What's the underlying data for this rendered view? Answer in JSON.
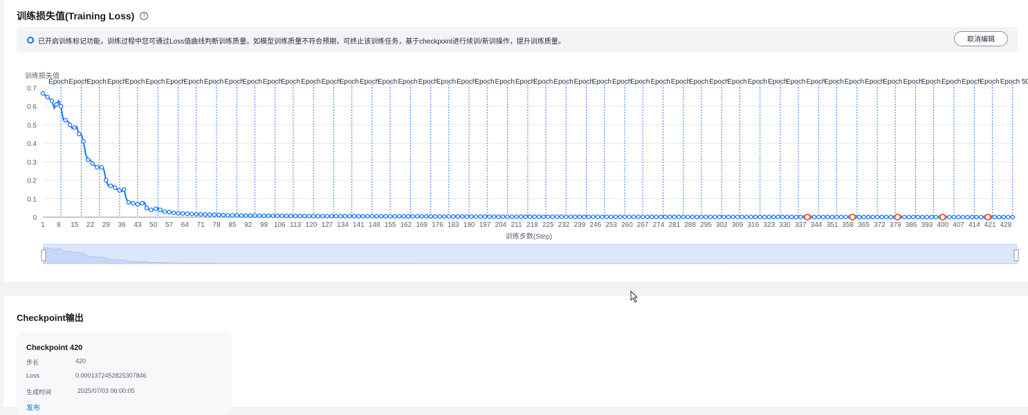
{
  "loss_section": {
    "title": "训练损失值(Training Loss)",
    "help_icon": "question-circle-icon",
    "notice": {
      "icon": "radio-info-icon",
      "text": "已开启训练标记功能，训练过程中您可通过Loss值曲线判断训练质量。如模型训练质量不符合预期，可终止该训练任务，基于checkpoint进行续训/新训操作，提升训练质量。",
      "button_label": "取消编辑"
    }
  },
  "colors": {
    "line": "#1476ff",
    "marker": "#ff5b2a",
    "grid": "#e6e8ec",
    "epoch_line": "#2e7cf6",
    "zoom_fill": "#dce7fb"
  },
  "chart_data": {
    "type": "line",
    "ylabel": "训练损失值",
    "xlabel": "训练步数(Step)",
    "ylim": [
      0,
      0.7
    ],
    "yticks": [
      0,
      0.1,
      0.2,
      0.3,
      0.4,
      0.5,
      0.6,
      0.7
    ],
    "xlim": [
      1,
      432
    ],
    "xticks": [
      1,
      8,
      15,
      22,
      29,
      36,
      43,
      50,
      57,
      64,
      71,
      78,
      85,
      92,
      99,
      106,
      113,
      120,
      127,
      134,
      141,
      148,
      155,
      162,
      169,
      176,
      183,
      190,
      197,
      204,
      211,
      218,
      225,
      232,
      239,
      246,
      253,
      260,
      267,
      274,
      281,
      288,
      295,
      302,
      309,
      316,
      323,
      330,
      337,
      344,
      351,
      358,
      365,
      372,
      379,
      386,
      393,
      400,
      407,
      414,
      421,
      428
    ],
    "epoch_label": "Epoch",
    "epoch_last_number": "50",
    "epoch_steps": [
      9,
      18,
      26,
      35,
      43,
      52,
      61,
      69,
      78,
      87,
      95,
      104,
      112,
      121,
      130,
      138,
      147,
      155,
      164,
      173,
      181,
      190,
      198,
      207,
      216,
      224,
      233,
      242,
      250,
      259,
      267,
      276,
      285,
      293,
      302,
      310,
      319,
      328,
      336,
      345,
      353,
      362,
      371,
      379,
      388,
      396,
      405,
      414,
      422,
      431
    ],
    "loss_curve": [
      [
        1,
        0.67
      ],
      [
        3,
        0.65
      ],
      [
        5,
        0.63
      ],
      [
        6,
        0.59
      ],
      [
        7,
        0.61
      ],
      [
        8,
        0.63
      ],
      [
        9,
        0.6
      ],
      [
        10,
        0.53
      ],
      [
        12,
        0.52
      ],
      [
        14,
        0.48
      ],
      [
        16,
        0.49
      ],
      [
        17,
        0.45
      ],
      [
        18,
        0.45
      ],
      [
        19,
        0.41
      ],
      [
        20,
        0.34
      ],
      [
        21,
        0.31
      ],
      [
        22,
        0.31
      ],
      [
        23,
        0.29
      ],
      [
        25,
        0.27
      ],
      [
        27,
        0.27
      ],
      [
        28,
        0.26
      ],
      [
        29,
        0.2
      ],
      [
        30,
        0.17
      ],
      [
        32,
        0.17
      ],
      [
        34,
        0.15
      ],
      [
        36,
        0.14
      ],
      [
        37,
        0.15
      ],
      [
        38,
        0.1
      ],
      [
        39,
        0.08
      ],
      [
        40,
        0.08
      ],
      [
        42,
        0.07
      ],
      [
        44,
        0.07
      ],
      [
        46,
        0.08
      ],
      [
        47,
        0.05
      ],
      [
        48,
        0.04
      ],
      [
        50,
        0.04
      ],
      [
        52,
        0.05
      ],
      [
        54,
        0.03
      ],
      [
        56,
        0.03
      ],
      [
        58,
        0.025
      ],
      [
        60,
        0.022
      ],
      [
        63,
        0.02
      ],
      [
        66,
        0.018
      ],
      [
        70,
        0.016
      ],
      [
        75,
        0.014
      ],
      [
        80,
        0.012
      ],
      [
        85,
        0.01
      ],
      [
        90,
        0.009
      ],
      [
        100,
        0.008
      ],
      [
        120,
        0.006
      ],
      [
        150,
        0.005
      ],
      [
        200,
        0.003
      ],
      [
        250,
        0.002
      ],
      [
        300,
        0.0015
      ],
      [
        350,
        0.001
      ],
      [
        400,
        0.0005
      ],
      [
        432,
        0.0002
      ]
    ],
    "checkpoint_steps": [
      340,
      360,
      380,
      400,
      420
    ]
  },
  "checkpoint_section": {
    "title": "Checkpoint输出",
    "card": {
      "name": "Checkpoint 420",
      "step_label": "步长",
      "step_value": "420",
      "loss_label": "Loss",
      "loss_value": "0.00013724528253078​46",
      "time_label": "生成时间",
      "time_value": "2025/07/03 06:00:05",
      "publish_label": "发布"
    }
  }
}
